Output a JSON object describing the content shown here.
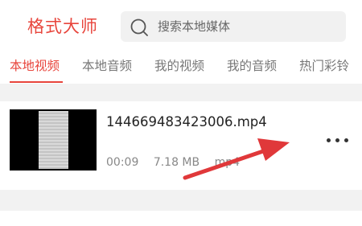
{
  "header": {
    "app_title": "格式大师",
    "search": {
      "placeholder": "搜索本地媒体",
      "icon": "search-icon"
    }
  },
  "tabs": [
    {
      "label": "本地视频",
      "active": true
    },
    {
      "label": "本地音频",
      "active": false
    },
    {
      "label": "我的视频",
      "active": false
    },
    {
      "label": "我的音频",
      "active": false
    },
    {
      "label": "热门彩铃",
      "active": false
    }
  ],
  "media_item": {
    "filename": "144669483423006.mp4",
    "duration": "00:09",
    "size": "7.18 MB",
    "format": "mp4",
    "more_icon": "more-options-icon"
  },
  "colors": {
    "accent": "#e8453c",
    "arrow": "#e0383a",
    "divider": "#f2f2f2"
  }
}
